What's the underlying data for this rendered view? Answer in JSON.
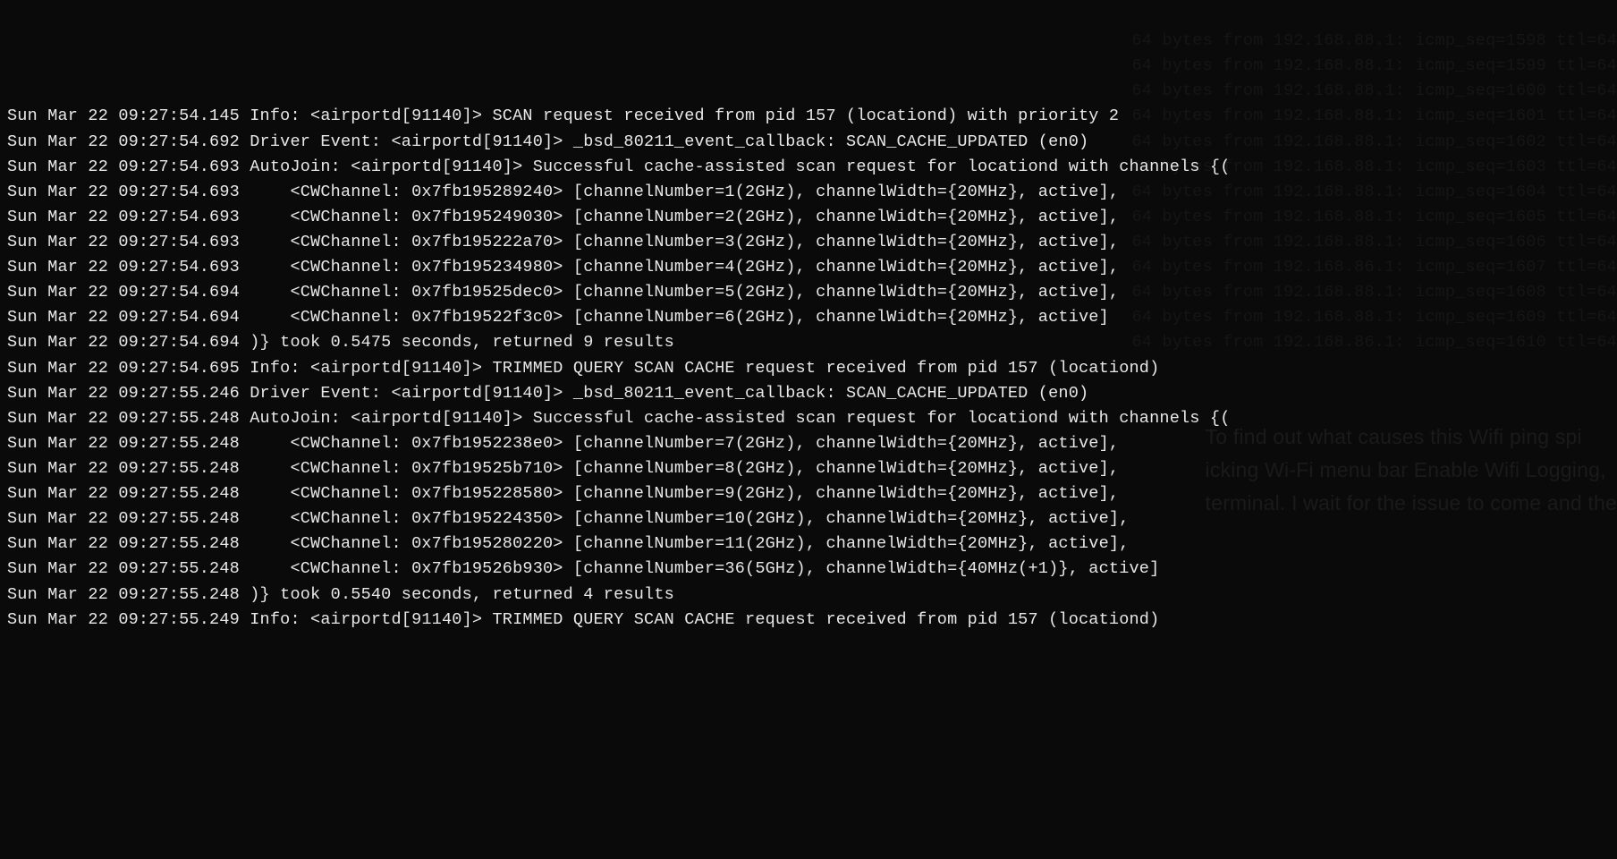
{
  "log_lines": [
    "Sun Mar 22 09:27:54.145 Info: <airportd[91140]> SCAN request received from pid 157 (locationd) with priority 2",
    "Sun Mar 22 09:27:54.692 Driver Event: <airportd[91140]> _bsd_80211_event_callback: SCAN_CACHE_UPDATED (en0)",
    "Sun Mar 22 09:27:54.693 AutoJoin: <airportd[91140]> Successful cache-assisted scan request for locationd with channels {(",
    "Sun Mar 22 09:27:54.693     <CWChannel: 0x7fb195289240> [channelNumber=1(2GHz), channelWidth={20MHz}, active],",
    "Sun Mar 22 09:27:54.693     <CWChannel: 0x7fb195249030> [channelNumber=2(2GHz), channelWidth={20MHz}, active],",
    "Sun Mar 22 09:27:54.693     <CWChannel: 0x7fb195222a70> [channelNumber=3(2GHz), channelWidth={20MHz}, active],",
    "Sun Mar 22 09:27:54.693     <CWChannel: 0x7fb195234980> [channelNumber=4(2GHz), channelWidth={20MHz}, active],",
    "Sun Mar 22 09:27:54.694     <CWChannel: 0x7fb19525dec0> [channelNumber=5(2GHz), channelWidth={20MHz}, active],",
    "Sun Mar 22 09:27:54.694     <CWChannel: 0x7fb19522f3c0> [channelNumber=6(2GHz), channelWidth={20MHz}, active]",
    "Sun Mar 22 09:27:54.694 )} took 0.5475 seconds, returned 9 results",
    "Sun Mar 22 09:27:54.695 Info: <airportd[91140]> TRIMMED QUERY SCAN CACHE request received from pid 157 (locationd)",
    "Sun Mar 22 09:27:55.246 Driver Event: <airportd[91140]> _bsd_80211_event_callback: SCAN_CACHE_UPDATED (en0)",
    "Sun Mar 22 09:27:55.248 AutoJoin: <airportd[91140]> Successful cache-assisted scan request for locationd with channels {(",
    "Sun Mar 22 09:27:55.248     <CWChannel: 0x7fb1952238e0> [channelNumber=7(2GHz), channelWidth={20MHz}, active],",
    "Sun Mar 22 09:27:55.248     <CWChannel: 0x7fb19525b710> [channelNumber=8(2GHz), channelWidth={20MHz}, active],",
    "Sun Mar 22 09:27:55.248     <CWChannel: 0x7fb195228580> [channelNumber=9(2GHz), channelWidth={20MHz}, active],",
    "Sun Mar 22 09:27:55.248     <CWChannel: 0x7fb195224350> [channelNumber=10(2GHz), channelWidth={20MHz}, active],",
    "Sun Mar 22 09:27:55.248     <CWChannel: 0x7fb195280220> [channelNumber=11(2GHz), channelWidth={20MHz}, active],",
    "Sun Mar 22 09:27:55.248     <CWChannel: 0x7fb19526b930> [channelNumber=36(5GHz), channelWidth={40MHz(+1)}, active]",
    "Sun Mar 22 09:27:55.248 )} took 0.5540 seconds, returned 4 results",
    "Sun Mar 22 09:27:55.249 Info: <airportd[91140]> TRIMMED QUERY SCAN CACHE request received from pid 157 (locationd)"
  ],
  "ghost_ping_lines": [
    "                                          ",
    "64 bytes from 192.168.88.1: icmp_seq=1598 ttl=64",
    "64 bytes from 192.168.88.1: icmp_seq=1599 ttl=64",
    "64 bytes from 192.168.88.1: icmp_seq=1600 ttl=64",
    "64 bytes from 192.168.88.1: icmp_seq=1601 ttl=64",
    "64 bytes from 192.168.88.1: icmp_seq=1602 ttl=64",
    "64 bytes from 192.168.88.1: icmp_seq=1603 ttl=64",
    "64 bytes from 192.168.88.1: icmp_seq=1604 ttl=64",
    "64 bytes from 192.168.88.1: icmp_seq=1605 ttl=64",
    "64 bytes from 192.168.88.1: icmp_seq=1606 ttl=64",
    "64 bytes from 192.168.86.1: icmp_seq=1607 ttl=64",
    "64 bytes from 192.168.88.1: icmp_seq=1608 ttl=64",
    "64 bytes from 192.168.88.1: icmp_seq=1609 ttl=64",
    "64 bytes from 192.168.86.1: icmp_seq=1610 ttl=64"
  ],
  "ghost_article_lines": [
    "To find out what causes this Wifi ping spi",
    "icking Wi-Fi menu bar Enable Wifi Logging,",
    "terminal. I wait for the issue to come and the"
  ]
}
